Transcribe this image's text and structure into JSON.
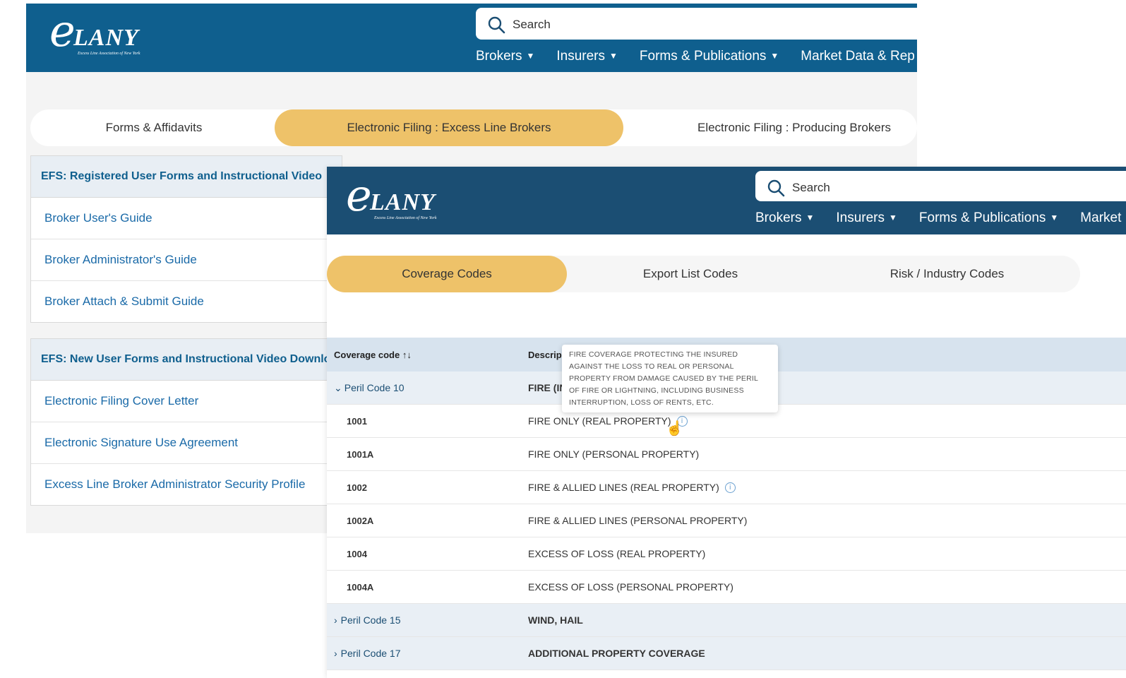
{
  "logo": {
    "letter": "e",
    "word": "LANY",
    "tagline": "Excess Line Association of New York"
  },
  "search": {
    "placeholder": "Search"
  },
  "nav_back": [
    {
      "label": "Brokers"
    },
    {
      "label": "Insurers"
    },
    {
      "label": "Forms & Publications"
    },
    {
      "label": "Market Data & Rep"
    }
  ],
  "nav_front": [
    {
      "label": "Brokers"
    },
    {
      "label": "Insurers"
    },
    {
      "label": "Forms & Publications"
    },
    {
      "label": "Market"
    }
  ],
  "back_tabs": [
    "Forms & Affidavits",
    "Electronic Filing : Excess Line Brokers",
    "Electronic Filing : Producing Brokers"
  ],
  "box1": {
    "title": "EFS: Registered User Forms and Instructional Video",
    "links": [
      "Broker User's Guide",
      "Broker Administrator's Guide",
      "Broker Attach & Submit Guide"
    ]
  },
  "box2": {
    "title": "EFS: New User Forms and Instructional Video Downloa",
    "links": [
      "Electronic Filing Cover Letter",
      "Electronic Signature Use Agreement",
      "Excess Line Broker Administrator Security Profile"
    ]
  },
  "front_tabs": [
    "Coverage Codes",
    "Export List Codes",
    "Risk / Industry Codes"
  ],
  "table": {
    "col1": "Coverage code",
    "sort_icon": "↑↓",
    "col2": "Descrip",
    "rows": [
      {
        "code": "Peril Code 10",
        "desc": "FIRE (IN",
        "group": true,
        "expanded": true
      },
      {
        "code": "1001",
        "desc": "FIRE ONLY (REAL PROPERTY)",
        "info": true
      },
      {
        "code": "1001A",
        "desc": "FIRE ONLY (PERSONAL PROPERTY)"
      },
      {
        "code": "1002",
        "desc": "FIRE & ALLIED LINES (REAL PROPERTY)",
        "info": true
      },
      {
        "code": "1002A",
        "desc": "FIRE & ALLIED LINES (PERSONAL PROPERTY)"
      },
      {
        "code": "1004",
        "desc": "EXCESS OF LOSS (REAL PROPERTY)"
      },
      {
        "code": "1004A",
        "desc": "EXCESS OF LOSS (PERSONAL PROPERTY)"
      },
      {
        "code": "Peril Code 15",
        "desc": "WIND, HAIL",
        "group": true
      },
      {
        "code": "Peril Code 17",
        "desc": "ADDITIONAL PROPERTY COVERAGE",
        "group": true
      }
    ]
  },
  "tooltip": {
    "lines": [
      "FIRE COVERAGE PROTECTING THE INSURED",
      "AGAINST THE LOSS TO REAL OR PERSONAL",
      "PROPERTY FROM DAMAGE CAUSED BY THE PERIL",
      "OF FIRE OR LIGHTNING, INCLUDING BUSINESS",
      "INTERRUPTION, LOSS OF RENTS, ETC."
    ]
  },
  "colors": {
    "header_back": "#0f5f8e",
    "header_front": "#1b4e73",
    "accent_tab": "#eec269",
    "link": "#1a6aa8"
  },
  "icons": {
    "search": "search-icon",
    "caret": "caret-down-icon",
    "info": "info-icon",
    "cursor": "hand-pointer-icon"
  }
}
